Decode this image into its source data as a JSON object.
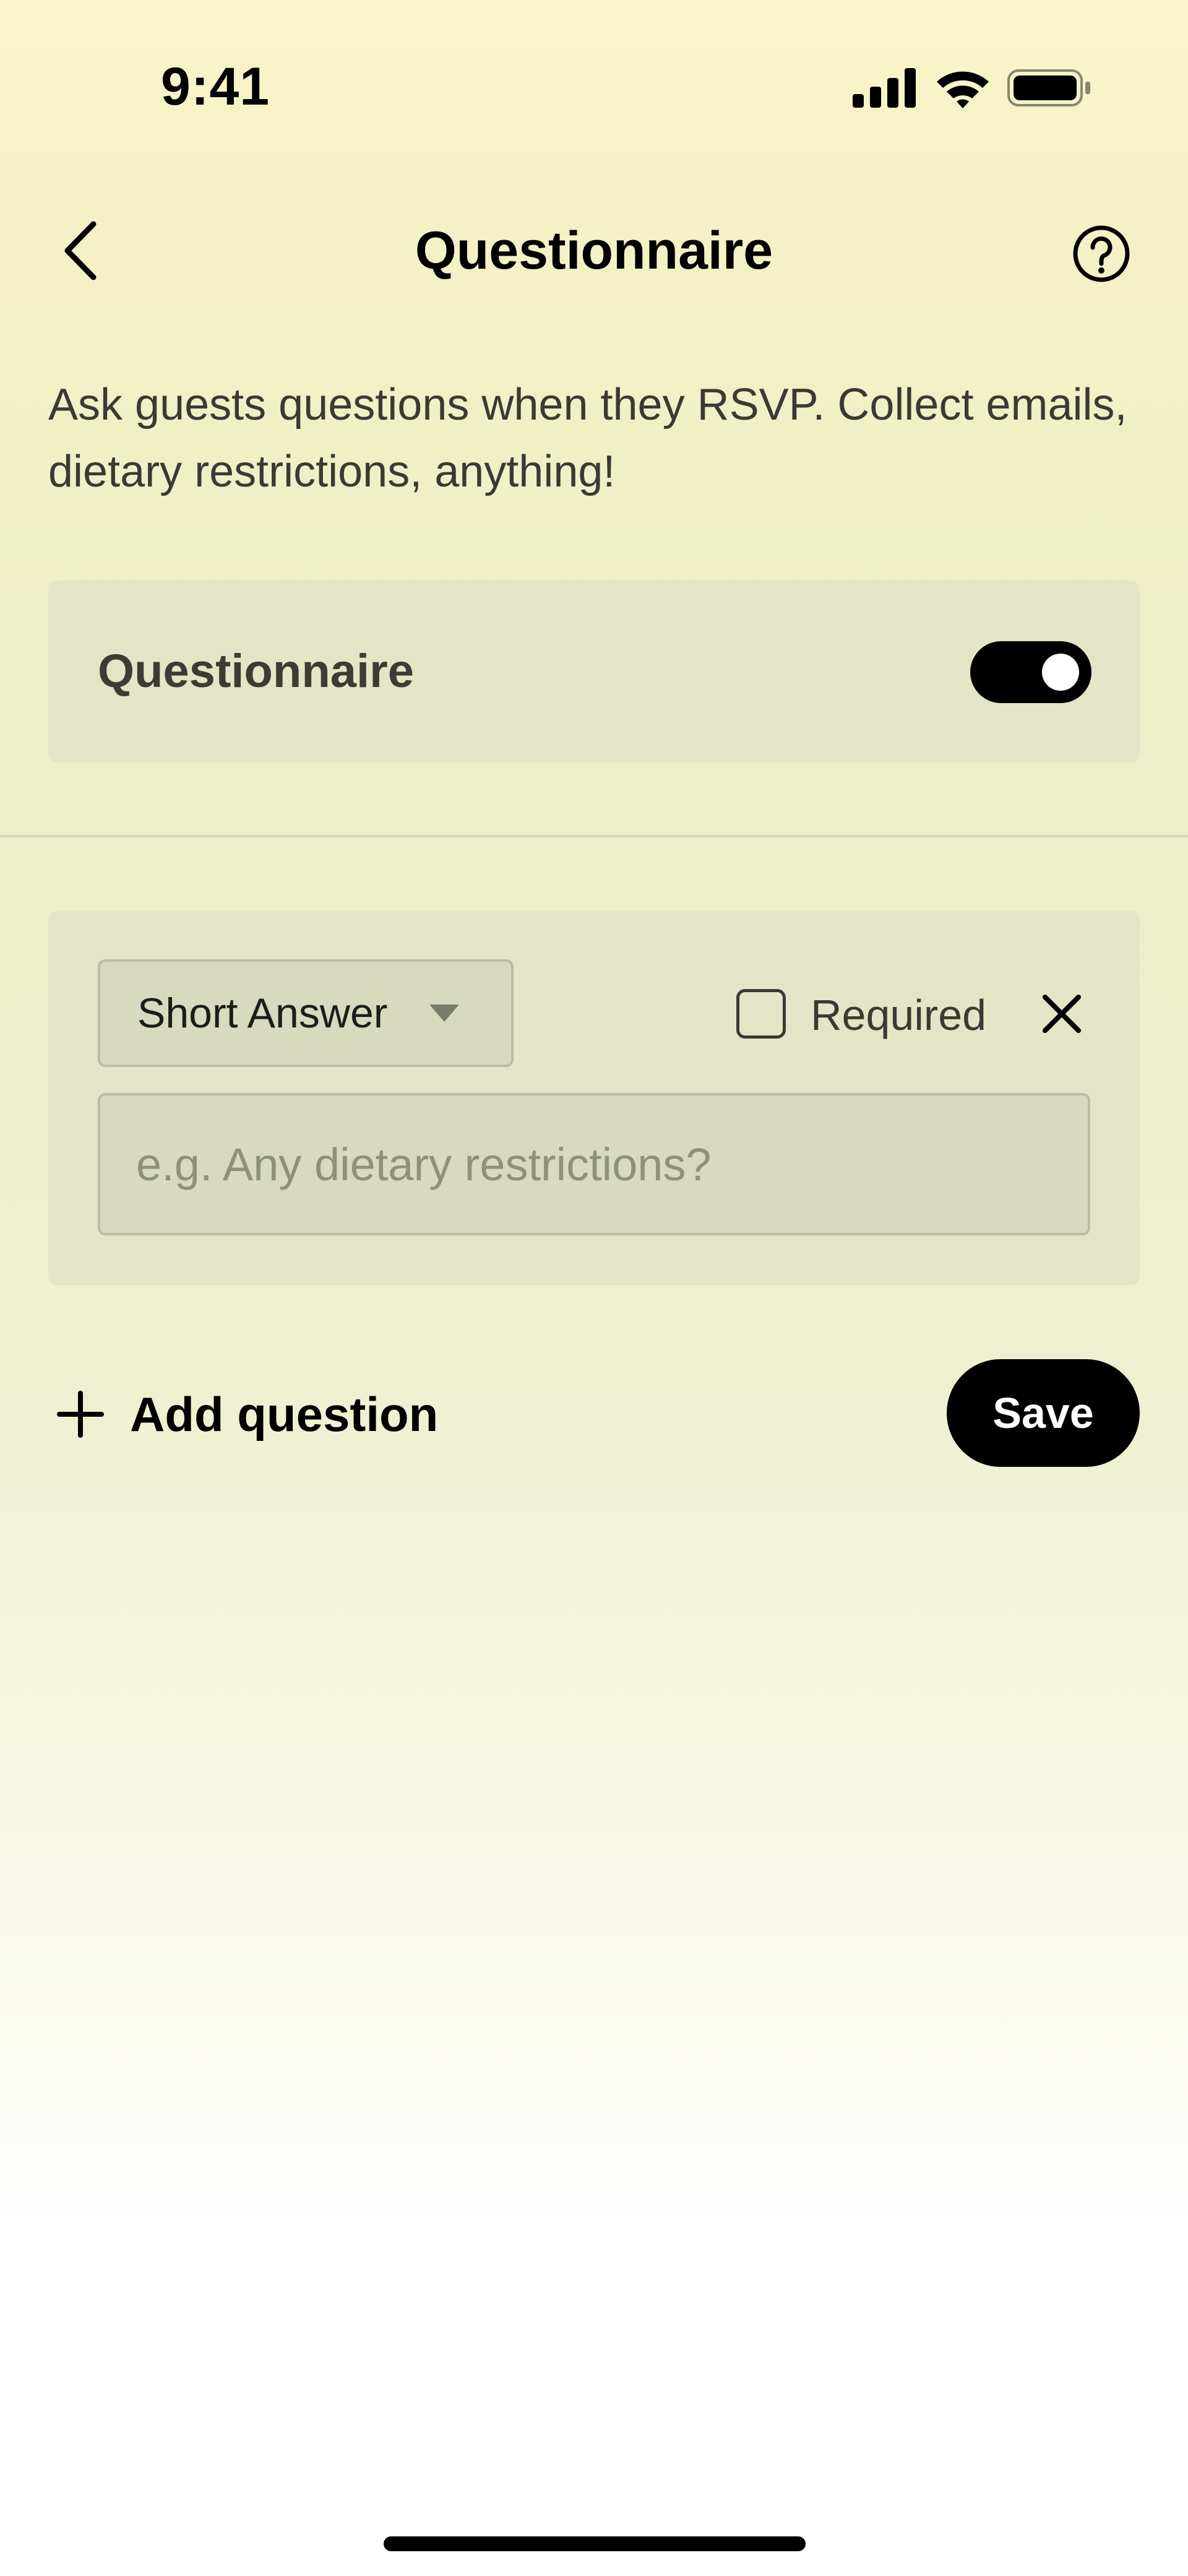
{
  "status_bar": {
    "time": "9:41",
    "icons": [
      "cellular-signal-icon",
      "wifi-icon",
      "battery-icon"
    ]
  },
  "header": {
    "title": "Questionnaire",
    "back_icon": "chevron-left-icon",
    "help_icon": "question-circle-icon"
  },
  "description": "Ask guests questions when they RSVP. Collect emails, dietary restrictions, anything!",
  "questionnaire_toggle": {
    "label": "Questionnaire",
    "enabled": true
  },
  "questions": [
    {
      "type_label": "Short Answer",
      "required_label": "Required",
      "required": false,
      "input_placeholder": "e.g. Any dietary restrictions?",
      "input_value": ""
    }
  ],
  "actions": {
    "add_question_label": "Add question",
    "save_label": "Save"
  },
  "colors": {
    "accent": "#000000",
    "card": "#e3e5c6",
    "background_top": "#fbf4c8"
  }
}
